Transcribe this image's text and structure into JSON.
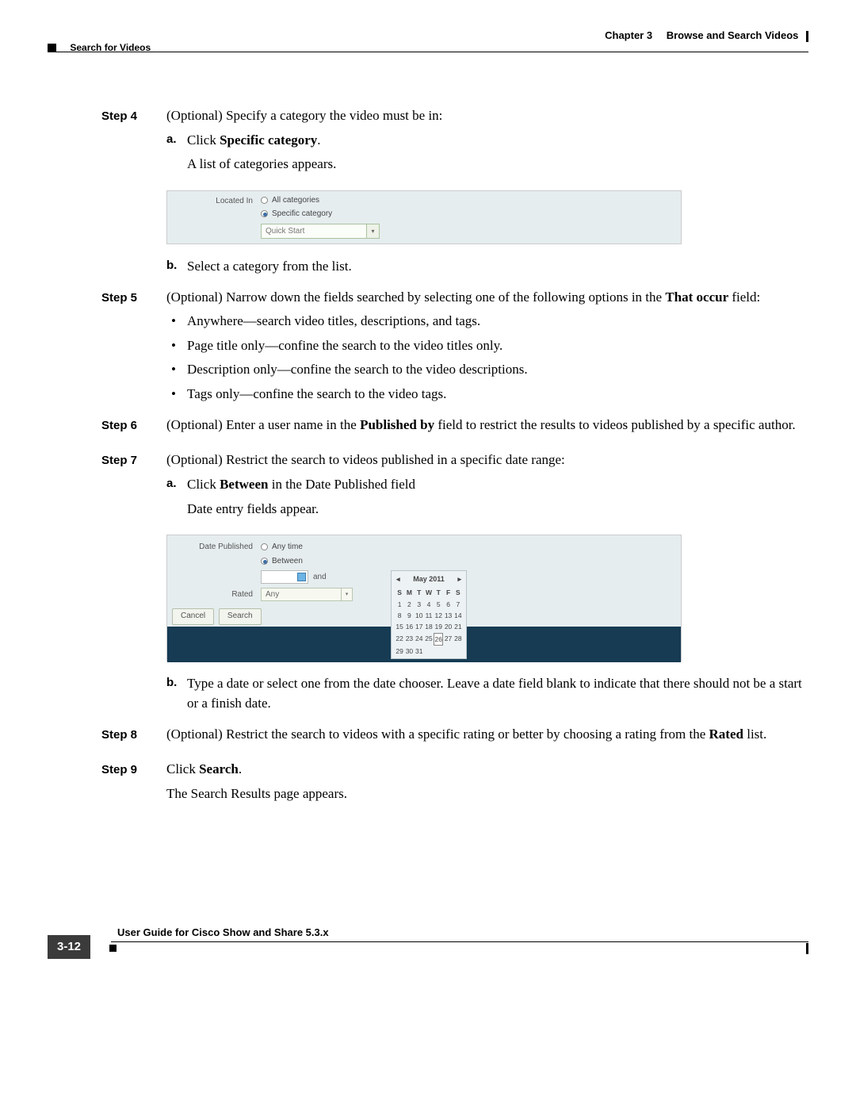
{
  "header": {
    "chapter_label": "Chapter 3",
    "chapter_title": "Browse and Search Videos",
    "section": "Search for Videos"
  },
  "steps": {
    "s4": {
      "label": "Step 4",
      "intro": "(Optional) Specify a category the video must be in:",
      "a_marker": "a.",
      "a_pre": "Click ",
      "a_bold": "Specific category",
      "a_post": ".",
      "a_line2": "A list of categories appears.",
      "b_marker": "b.",
      "b_text": "Select a category from the list."
    },
    "s5": {
      "label": "Step 5",
      "intro_pre": "(Optional) Narrow down the fields searched by selecting one of the following options in the ",
      "intro_bold": "That occur",
      "intro_post": " field:",
      "bullets": [
        "Anywhere—search video titles, descriptions, and tags.",
        "Page title only—confine the search to the video titles only.",
        "Description only—confine the search to the video descriptions.",
        "Tags only—confine the search to the video tags."
      ]
    },
    "s6": {
      "label": "Step 6",
      "pre": "(Optional) Enter a user name in the ",
      "bold": "Published by",
      "post": " field to restrict the results to videos published by a specific author."
    },
    "s7": {
      "label": "Step 7",
      "intro": "(Optional) Restrict the search to videos published in a specific date range:",
      "a_marker": "a.",
      "a_pre": "Click ",
      "a_bold": "Between",
      "a_post": " in the Date Published field",
      "a_line2": "Date entry fields appear.",
      "b_marker": "b.",
      "b_text": "Type a date or select one from the date chooser. Leave a date field blank to indicate that there should not be a start or a finish date."
    },
    "s8": {
      "label": "Step 8",
      "pre": "(Optional) Restrict the search to videos with a specific rating or better by choosing a rating from the ",
      "bold": "Rated",
      "post": " list."
    },
    "s9": {
      "label": "Step 9",
      "pre": "Click ",
      "bold": "Search",
      "post": ".",
      "line2": "The Search Results page appears."
    }
  },
  "shot1": {
    "label": "Located In",
    "opt1": "All categories",
    "opt2": "Specific category",
    "dropdown": "Quick Start"
  },
  "shot2": {
    "label1": "Date Published",
    "label2": "Rated",
    "opt1": "Any time",
    "opt2": "Between",
    "and": "and",
    "rated_value": "Any",
    "btn_cancel": "Cancel",
    "btn_search": "Search",
    "cal_month": "May",
    "cal_year": "2011",
    "dow": [
      "S",
      "M",
      "T",
      "W",
      "T",
      "F",
      "S"
    ],
    "days": [
      [
        "1",
        "2",
        "3",
        "4",
        "5",
        "6",
        "7"
      ],
      [
        "8",
        "9",
        "10",
        "11",
        "12",
        "13",
        "14"
      ],
      [
        "15",
        "16",
        "17",
        "18",
        "19",
        "20",
        "21"
      ],
      [
        "22",
        "23",
        "24",
        "25",
        "26",
        "27",
        "28"
      ],
      [
        "29",
        "30",
        "31",
        "",
        "",
        "",
        ""
      ]
    ],
    "selected_day": "26"
  },
  "footer": {
    "title": "User Guide for Cisco Show and Share 5.3.x",
    "page": "3-12"
  }
}
